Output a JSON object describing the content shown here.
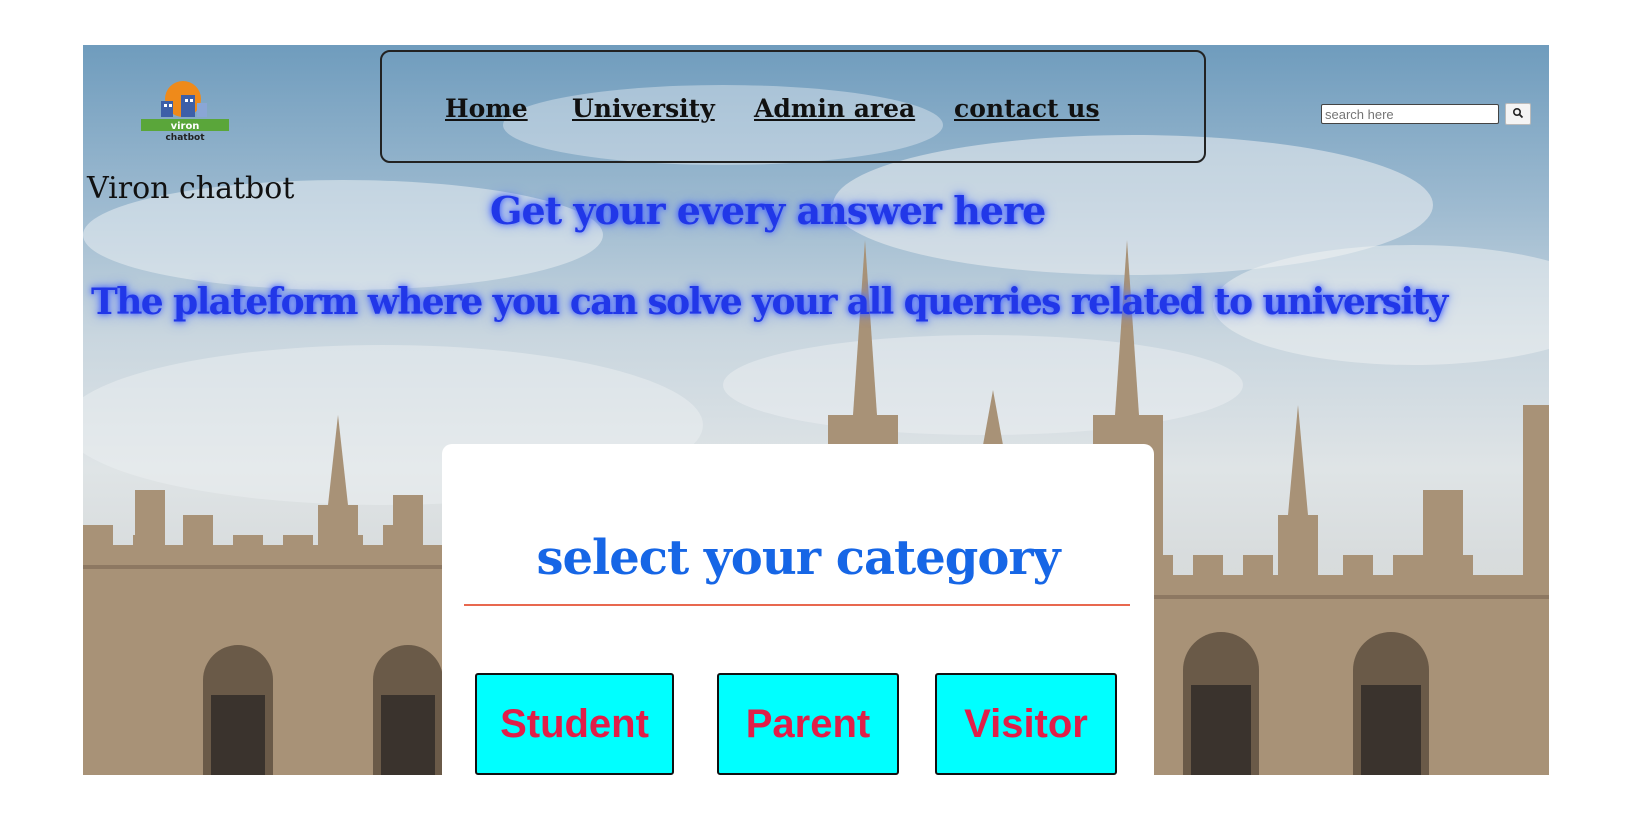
{
  "brand": {
    "logo_text": "viron chatbot",
    "name": "Viron chatbot"
  },
  "nav": {
    "items": [
      {
        "label": "Home"
      },
      {
        "label": "University"
      },
      {
        "label": "Admin area"
      },
      {
        "label": "contact us"
      }
    ]
  },
  "search": {
    "placeholder": "search here",
    "button_icon": "search-icon"
  },
  "hero": {
    "tagline": "Get your every answer here",
    "subtitle": "The plateform where you can solve your all querries related to university"
  },
  "category_card": {
    "title": "select your category",
    "buttons": [
      {
        "label": "Student"
      },
      {
        "label": "Parent"
      },
      {
        "label": "Visitor"
      }
    ]
  },
  "colors": {
    "headline": "#2137e8",
    "card_title": "#1666e6",
    "button_bg": "#00ffff",
    "button_text": "#e11e48",
    "rule": "#e8684f"
  }
}
